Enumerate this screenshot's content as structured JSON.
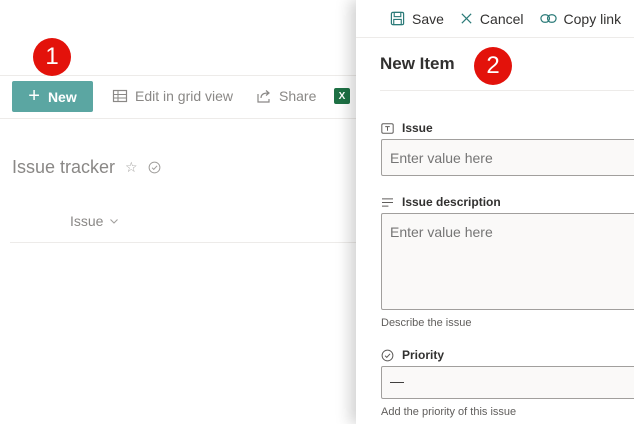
{
  "commandbar": {
    "new_label": "New",
    "edit_grid_label": "Edit in grid view",
    "share_label": "Share",
    "excel_glyph": "X"
  },
  "list": {
    "title": "Issue tracker",
    "column_header": "Issue"
  },
  "badges": {
    "one": "1",
    "two": "2"
  },
  "panel": {
    "save_label": "Save",
    "cancel_label": "Cancel",
    "copy_link_label": "Copy link",
    "title": "New Item",
    "fields": {
      "issue": {
        "label": "Issue",
        "placeholder": "Enter value here"
      },
      "description": {
        "label": "Issue description",
        "placeholder": "Enter value here",
        "hint": "Describe the issue"
      },
      "priority": {
        "label": "Priority",
        "value": "—",
        "hint": "Add the priority of this issue"
      }
    }
  },
  "colors": {
    "new_button": "#5ba6a2",
    "badge": "#e3120b",
    "excel": "#1e7145"
  }
}
